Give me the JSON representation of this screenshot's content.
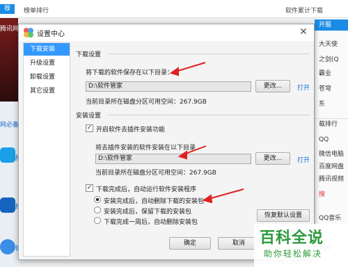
{
  "background": {
    "top_tab_active": "荐",
    "top_tab_ranking": "榜单排行",
    "top_right_label": "软件累计下载",
    "banner_text": "腾讯网游",
    "left_mini_items": [
      "网必备",
      "腾",
      "腾",
      "微"
    ],
    "right_top": "开服",
    "right_items": [
      "大天使",
      "之剑(Q",
      "霸业",
      "苍穹",
      "东"
    ],
    "right_rank_title": "载排行",
    "right_list": [
      "QQ",
      "微信电脑",
      "百度网盘",
      "腾讯视频",
      "搜",
      "QQ音乐",
      "360"
    ]
  },
  "dialog": {
    "title": "设置中心",
    "close_icon": "close-icon",
    "nav": [
      {
        "label": "下载安装",
        "active": true
      },
      {
        "label": "升级设置",
        "active": false
      },
      {
        "label": "卸载设置",
        "active": false
      },
      {
        "label": "其它设置",
        "active": false
      }
    ],
    "download": {
      "section_title": "下载设置",
      "label": "将下载的软件保存在以下目录：",
      "path": "D:\\软件管家",
      "change_button": "更改...",
      "open_link": "打开",
      "space_text": "当前目录所在磁盘分区可用空间：267.9GB"
    },
    "install": {
      "section_title": "安装设置",
      "plugin_checkbox_label": "开启软件去插件安装功能",
      "plugin_checked": true,
      "plugin_dir_label": "将去插件安装的软件安装在以下目录",
      "path": "D:\\软件管家",
      "change_button": "更改...",
      "open_link": "打开",
      "space_text": "当前目录所在磁盘分区可用空间：267.9GB",
      "auto_install_label": "下载完成后，自动运行软件安装程序",
      "auto_install_checked": true,
      "radio_options": [
        {
          "label": "安装完成后，自动删除下载的安装包",
          "selected": true
        },
        {
          "label": "安装完成后，保留下载的安装包",
          "selected": false
        },
        {
          "label": "下载完成一周后，自动删除安装包",
          "selected": false
        }
      ],
      "restore_button": "恢复默认设置"
    },
    "ok_button": "确定",
    "cancel_button": "取消"
  },
  "watermark": {
    "title": "百科全说",
    "subtitle": "助你轻松解决"
  },
  "colors": {
    "accent": "#3399ff",
    "annotation_arrow": "#e02020",
    "link": "#1a6fd4",
    "watermark": "#2a9a3a"
  }
}
